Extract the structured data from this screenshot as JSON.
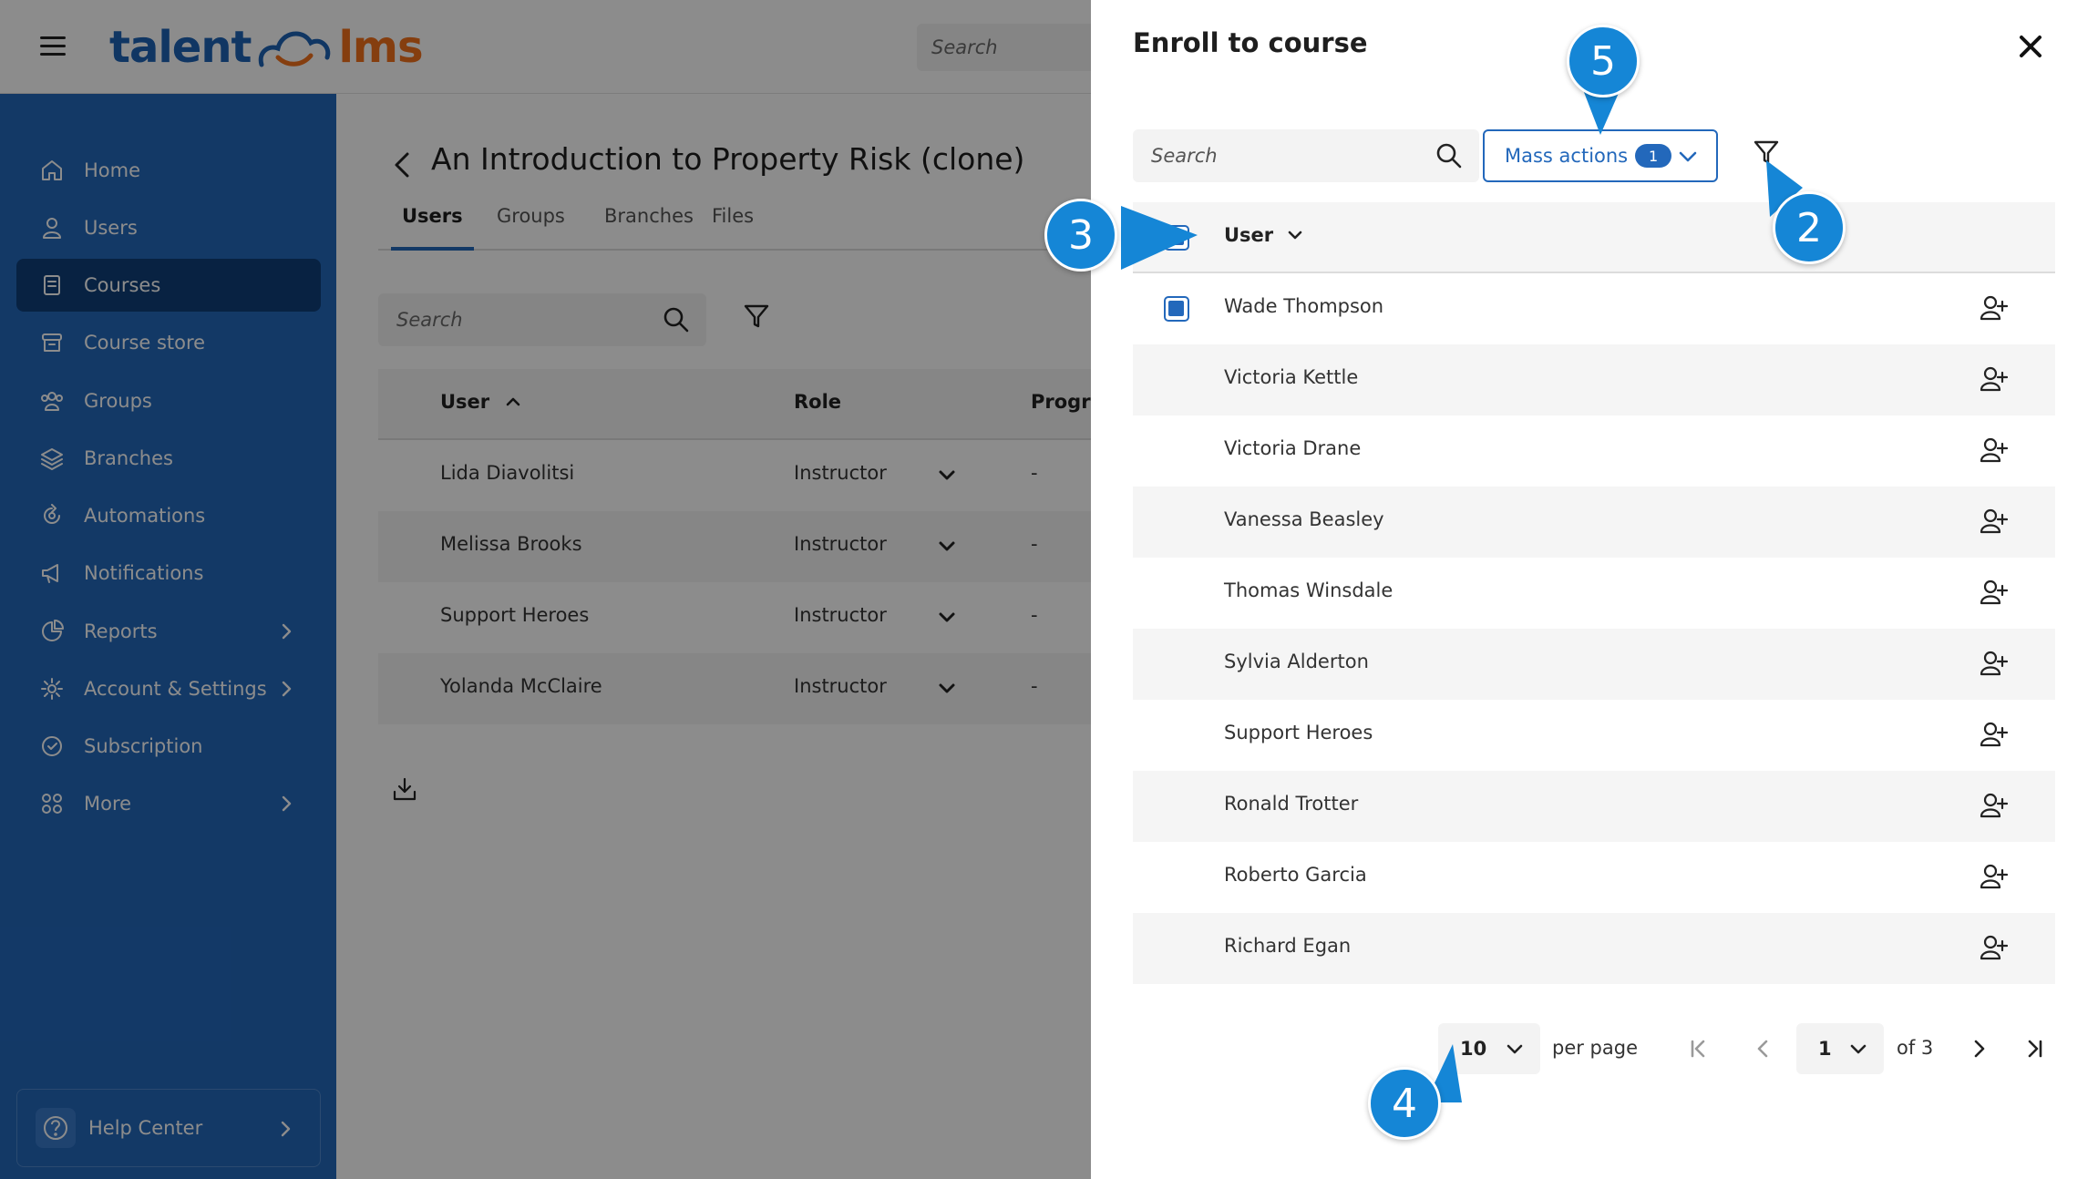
{
  "header": {
    "logo_left": "talent",
    "logo_right": "lms",
    "search_placeholder": "Search"
  },
  "sidebar": {
    "items": [
      {
        "label": "Home",
        "icon": "home-icon",
        "active": false,
        "has_submenu": false
      },
      {
        "label": "Users",
        "icon": "user-icon",
        "active": false,
        "has_submenu": false
      },
      {
        "label": "Courses",
        "icon": "courses-icon",
        "active": true,
        "has_submenu": false
      },
      {
        "label": "Course store",
        "icon": "store-icon",
        "active": false,
        "has_submenu": false
      },
      {
        "label": "Groups",
        "icon": "groups-icon",
        "active": false,
        "has_submenu": false
      },
      {
        "label": "Branches",
        "icon": "branches-icon",
        "active": false,
        "has_submenu": false
      },
      {
        "label": "Automations",
        "icon": "automations-icon",
        "active": false,
        "has_submenu": false
      },
      {
        "label": "Notifications",
        "icon": "megaphone-icon",
        "active": false,
        "has_submenu": false
      },
      {
        "label": "Reports",
        "icon": "pie-chart-icon",
        "active": false,
        "has_submenu": true
      },
      {
        "label": "Account & Settings",
        "icon": "gear-icon",
        "active": false,
        "has_submenu": true
      },
      {
        "label": "Subscription",
        "icon": "subscription-icon",
        "active": false,
        "has_submenu": false
      },
      {
        "label": "More",
        "icon": "grid-icon",
        "active": false,
        "has_submenu": true
      }
    ],
    "help_center": "Help Center"
  },
  "main": {
    "title": "An Introduction to Property Risk (clone)",
    "tabs": [
      "Users",
      "Groups",
      "Branches",
      "Files"
    ],
    "active_tab": "Users",
    "search_placeholder": "Search",
    "columns": {
      "user": "User",
      "role": "Role",
      "progress": "Progres"
    },
    "rows": [
      {
        "user": "Lida Diavolitsi",
        "role": "Instructor",
        "progress": "-"
      },
      {
        "user": "Melissa Brooks",
        "role": "Instructor",
        "progress": "-"
      },
      {
        "user": "Support Heroes",
        "role": "Instructor",
        "progress": "-"
      },
      {
        "user": "Yolanda McClaire",
        "role": "Instructor",
        "progress": "-"
      }
    ]
  },
  "panel": {
    "title": "Enroll to course",
    "search_placeholder": "Search",
    "mass_actions_label": "Mass actions",
    "mass_actions_count": "1",
    "column_user": "User",
    "users": [
      {
        "name": "Wade Thompson",
        "checked": true
      },
      {
        "name": "Victoria Kettle",
        "checked": false
      },
      {
        "name": "Victoria Drane",
        "checked": false
      },
      {
        "name": "Vanessa Beasley",
        "checked": false
      },
      {
        "name": "Thomas Winsdale",
        "checked": false
      },
      {
        "name": "Sylvia Alderton",
        "checked": false
      },
      {
        "name": "Support Heroes",
        "checked": false
      },
      {
        "name": "Ronald Trotter",
        "checked": false
      },
      {
        "name": "Roberto Garcia",
        "checked": false
      },
      {
        "name": "Richard Egan",
        "checked": false
      }
    ],
    "pagination": {
      "per_page_value": "10",
      "per_page_label": "per page",
      "page_value": "1",
      "page_of": "of 3"
    }
  },
  "callouts": [
    "2",
    "3",
    "4",
    "5"
  ],
  "colors": {
    "brand_blue": "#2368bb",
    "sidebar_active": "#0f3f78",
    "logo_orange": "#f2711c",
    "callout_blue": "#1586d6"
  }
}
